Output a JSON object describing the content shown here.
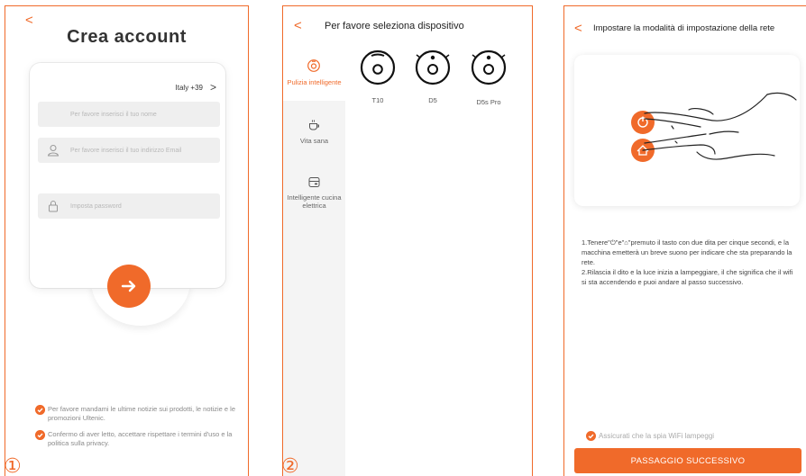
{
  "screen1": {
    "back": "<",
    "title": "Crea account",
    "country": "Italy +39",
    "chevron": ">",
    "name_placeholder": "Per favore inserisci il tuo nome",
    "email_placeholder": "Per favore inserisci il tuo indirizzo Email",
    "password_placeholder": "Imposta password",
    "consent_news": "Per favore mandami le ultime notizie sui prodotti, le notizie e le promozioni Ultenic.",
    "consent_terms": "Confermo di aver letto, accettare rispettare i termini d'uso e la politica sulla privacy.",
    "step": "①",
    "icons": [
      "user-icon",
      "lock-icon",
      "arrow-right-icon",
      "checkmark-icon"
    ]
  },
  "screen2": {
    "back": "<",
    "title": "Per favore seleziona  dispositivo",
    "categories": [
      {
        "label": "Pulizia intelligente",
        "icon": "vacuum-icon"
      },
      {
        "label": "Vita sana",
        "icon": "cup-icon"
      },
      {
        "label": "Intelligente cucina elettrica",
        "icon": "cooker-icon"
      }
    ],
    "devices": [
      {
        "label": "T10"
      },
      {
        "label": "D5"
      },
      {
        "label": "D5s Pro"
      }
    ],
    "step": "②"
  },
  "screen3": {
    "back": "<",
    "title": "Impostare la modalità di impostazione della rete",
    "instructions": [
      "1.Tenere\"⏻\"e\"⌂\"premuto il tasto con due dita per cinque secondi, e la macchina emetterà un breve suono per indicare che sta preparando la rete.",
      "2.Rilascia il dito e la luce inizia a lampeggiare, il che significa che il wifi si sta accendendo e puoi andare al passo successivo."
    ],
    "wifi_check": "Assicurati che la spia WiFi lampeggi",
    "next_button": "PASSAGGIO SUCCESSIVO"
  },
  "colors": {
    "accent": "#f06a2a",
    "field_bg": "#efefef",
    "sidebar_bg": "#f4f4f4"
  }
}
